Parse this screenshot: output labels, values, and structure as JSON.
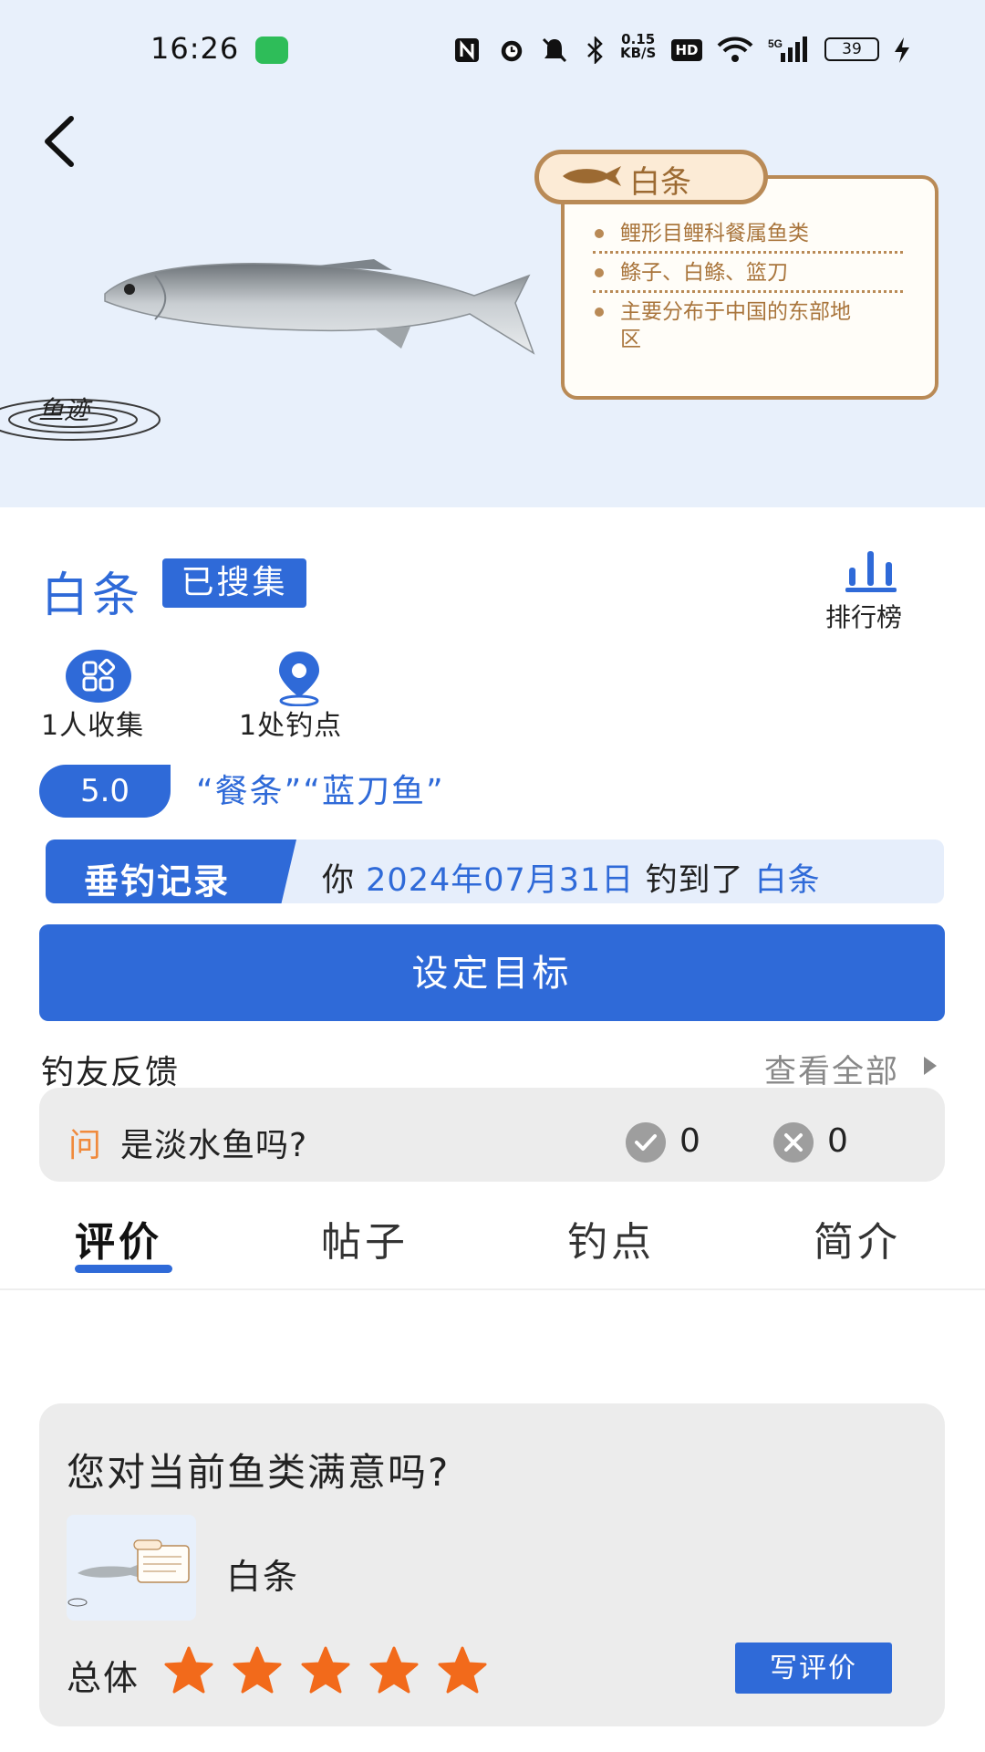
{
  "status_bar": {
    "time": "16:26",
    "net_speed": "0.15",
    "net_unit": "KB/S",
    "battery": "39"
  },
  "fish_info_card": {
    "name": "白条",
    "lines": [
      "鲤形目鲤科餐属鱼类",
      "鲦子、白鲦、篮刀",
      "主要分布于中国的东部地",
      "区"
    ]
  },
  "watermark": "鱼迹",
  "fish": {
    "name": "白条",
    "collected_badge": "已搜集",
    "ranking_label": "排行榜",
    "collectors": "1人收集",
    "spots": "1处钓点",
    "rating": "5.0",
    "aliases": "“餐条”“蓝刀鱼”"
  },
  "catch_record": {
    "tag": "垂钓记录",
    "prefix": "你",
    "date": "2024年07月31日",
    "middle": "钓到了",
    "fish": "白条"
  },
  "set_goal_label": "设定目标",
  "feedback": {
    "title": "钓友反馈",
    "view_all": "查看全部",
    "question_mark": "问",
    "question": "是淡水鱼吗?",
    "yes_count": "0",
    "no_count": "0"
  },
  "tabs": [
    "评价",
    "帖子",
    "钓点",
    "简介"
  ],
  "active_tab": 0,
  "satisfaction": {
    "title": "您对当前鱼类满意吗?",
    "fish_name": "白条",
    "overall_label": "总体",
    "stars": 5,
    "write_review": "写评价"
  },
  "colors": {
    "accent": "#2f6ad8",
    "card_border": "#b98a56",
    "star": "#f26a1b",
    "question_mark": "#f08a3c"
  }
}
